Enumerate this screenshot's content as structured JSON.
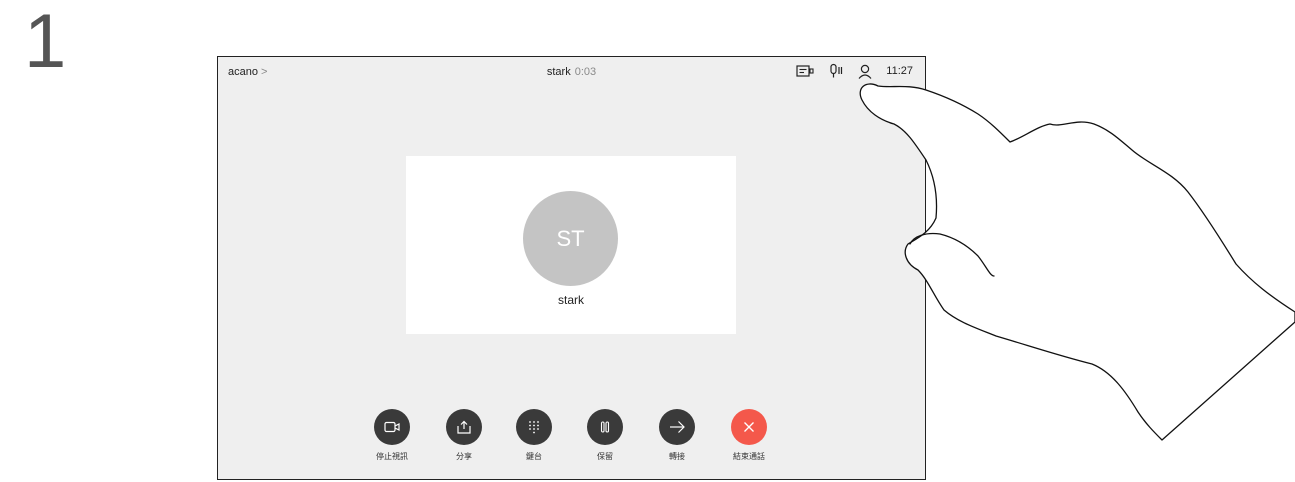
{
  "step_number": "1",
  "topbar": {
    "brand": "acano",
    "brand_chevron": ">",
    "call_name": "stark",
    "call_timer": "0:03",
    "clock": "11:27",
    "icons": [
      "layout-icon",
      "microphone-muted-icon",
      "person-icon"
    ]
  },
  "card": {
    "initials": "ST",
    "name": "stark"
  },
  "controls": [
    {
      "label": "停止視訊",
      "icon": "camera-icon"
    },
    {
      "label": "分享",
      "icon": "share-icon"
    },
    {
      "label": "鍵台",
      "icon": "keypad-icon"
    },
    {
      "label": "保留",
      "icon": "pause-icon"
    },
    {
      "label": "轉接",
      "icon": "arrow-right-icon"
    },
    {
      "label": "結束通話",
      "icon": "close-icon"
    }
  ],
  "colors": {
    "screen_bg": "#efefef",
    "button_dark": "#3a3a3a",
    "end_call_red": "#f4584b",
    "avatar_gray": "#c4c4c4"
  }
}
